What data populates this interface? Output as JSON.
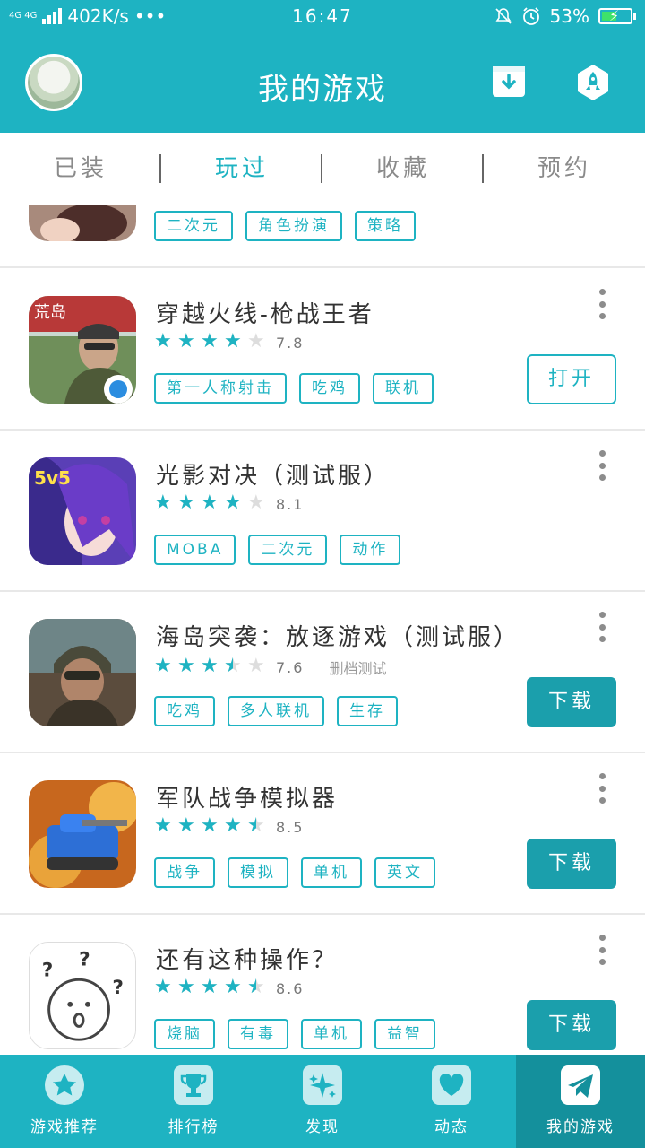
{
  "status_bar": {
    "network": "4G 4G",
    "speed": "402K/s",
    "dots": "•••",
    "time": "16:47",
    "battery": "53%",
    "battery_level": 0.53
  },
  "header": {
    "title": "我的游戏",
    "accent_color": "#1eb3c2"
  },
  "tabs": [
    {
      "label": "已装",
      "active": false
    },
    {
      "label": "玩过",
      "active": true
    },
    {
      "label": "收藏",
      "active": false
    },
    {
      "label": "预约",
      "active": false
    }
  ],
  "games": [
    {
      "name": "",
      "rating": null,
      "score": "",
      "note": "",
      "tags": [
        "二次元",
        "角色扮演",
        "策略"
      ],
      "action": ""
    },
    {
      "name": "穿越火线-枪战王者",
      "rating": 4,
      "score": "7.8",
      "note": "",
      "tags": [
        "第一人称射击",
        "吃鸡",
        "联机"
      ],
      "action": "打开",
      "action_type": "open"
    },
    {
      "name": "光影对决（测试服）",
      "rating": 4,
      "score": "8.1",
      "note": "",
      "tags": [
        "MOBA",
        "二次元",
        "动作"
      ],
      "action": "",
      "action_type": ""
    },
    {
      "name": "海岛突袭：放逐游戏（测试服）",
      "rating": 3.5,
      "score": "7.6",
      "note": "删档测试",
      "tags": [
        "吃鸡",
        "多人联机",
        "生存"
      ],
      "action": "下载",
      "action_type": "download"
    },
    {
      "name": "军队战争模拟器",
      "rating": 4.5,
      "score": "8.5",
      "note": "",
      "tags": [
        "战争",
        "模拟",
        "单机",
        "英文"
      ],
      "action": "下载",
      "action_type": "download"
    },
    {
      "name": "还有这种操作？",
      "rating": 4.5,
      "score": "8.6",
      "note": "",
      "tags": [
        "烧脑",
        "有毒",
        "单机",
        "益智"
      ],
      "action": "下载",
      "action_type": "download"
    }
  ],
  "bottom_nav": [
    {
      "label": "游戏推荐",
      "icon": "star-icon",
      "active": false
    },
    {
      "label": "排行榜",
      "icon": "trophy-icon",
      "active": false
    },
    {
      "label": "发现",
      "icon": "sparkle-icon",
      "active": false
    },
    {
      "label": "动态",
      "icon": "heart-icon",
      "active": false
    },
    {
      "label": "我的游戏",
      "icon": "paper-plane-icon",
      "active": true
    }
  ]
}
